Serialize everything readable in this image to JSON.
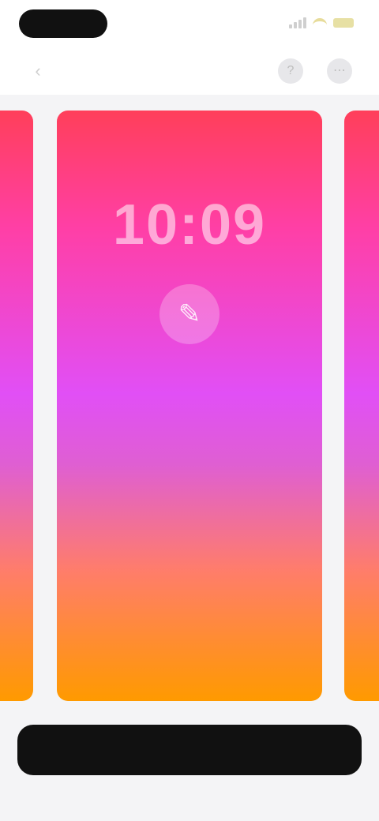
{
  "status_bar": {
    "icons": [
      "signal-icon",
      "wifi-icon",
      "battery-icon"
    ]
  },
  "header": {
    "back_icon": "chevron-left-icon",
    "title": "",
    "buttons": [
      {
        "icon": "help-icon",
        "glyph": "?"
      },
      {
        "icon": "more-icon",
        "glyph": "⋯"
      }
    ]
  },
  "carousel": {
    "current": {
      "time": "10:09",
      "edit_glyph": "✎"
    }
  },
  "bottom_bar": {
    "label": ""
  },
  "colors": {
    "gradient": [
      "#ff3f5a",
      "#ff3fa6",
      "#e14ff6",
      "#df5fd2",
      "#ff7d6a",
      "#ff9a00"
    ],
    "bottom_bar": "#111111"
  }
}
